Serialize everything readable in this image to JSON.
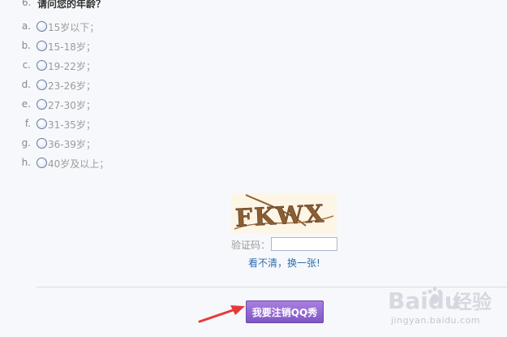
{
  "question": {
    "number": "6.",
    "text": "请问您的年龄？",
    "options": [
      {
        "letter": "a.",
        "label": "15岁以下；"
      },
      {
        "letter": "b.",
        "label": "15-18岁；"
      },
      {
        "letter": "c.",
        "label": "19-22岁；"
      },
      {
        "letter": "d.",
        "label": "23-26岁；"
      },
      {
        "letter": "e.",
        "label": "27-30岁；"
      },
      {
        "letter": "f.",
        "label": "31-35岁；"
      },
      {
        "letter": "g.",
        "label": "36-39岁；"
      },
      {
        "letter": "h.",
        "label": "40岁及以上；"
      }
    ]
  },
  "captcha": {
    "image_text": "FKWX",
    "label": "验证码：",
    "input_value": "",
    "refresh_link": "看不清，换一张!"
  },
  "submit": {
    "label": "我要注销QQ秀"
  },
  "watermark": {
    "brand": "Baidu",
    "sub": "jingyan.baidu.com",
    "suffix": "经验"
  },
  "colors": {
    "button": "#8e67d2",
    "link": "#2a6fb0",
    "arrow": "#e63a3a"
  }
}
